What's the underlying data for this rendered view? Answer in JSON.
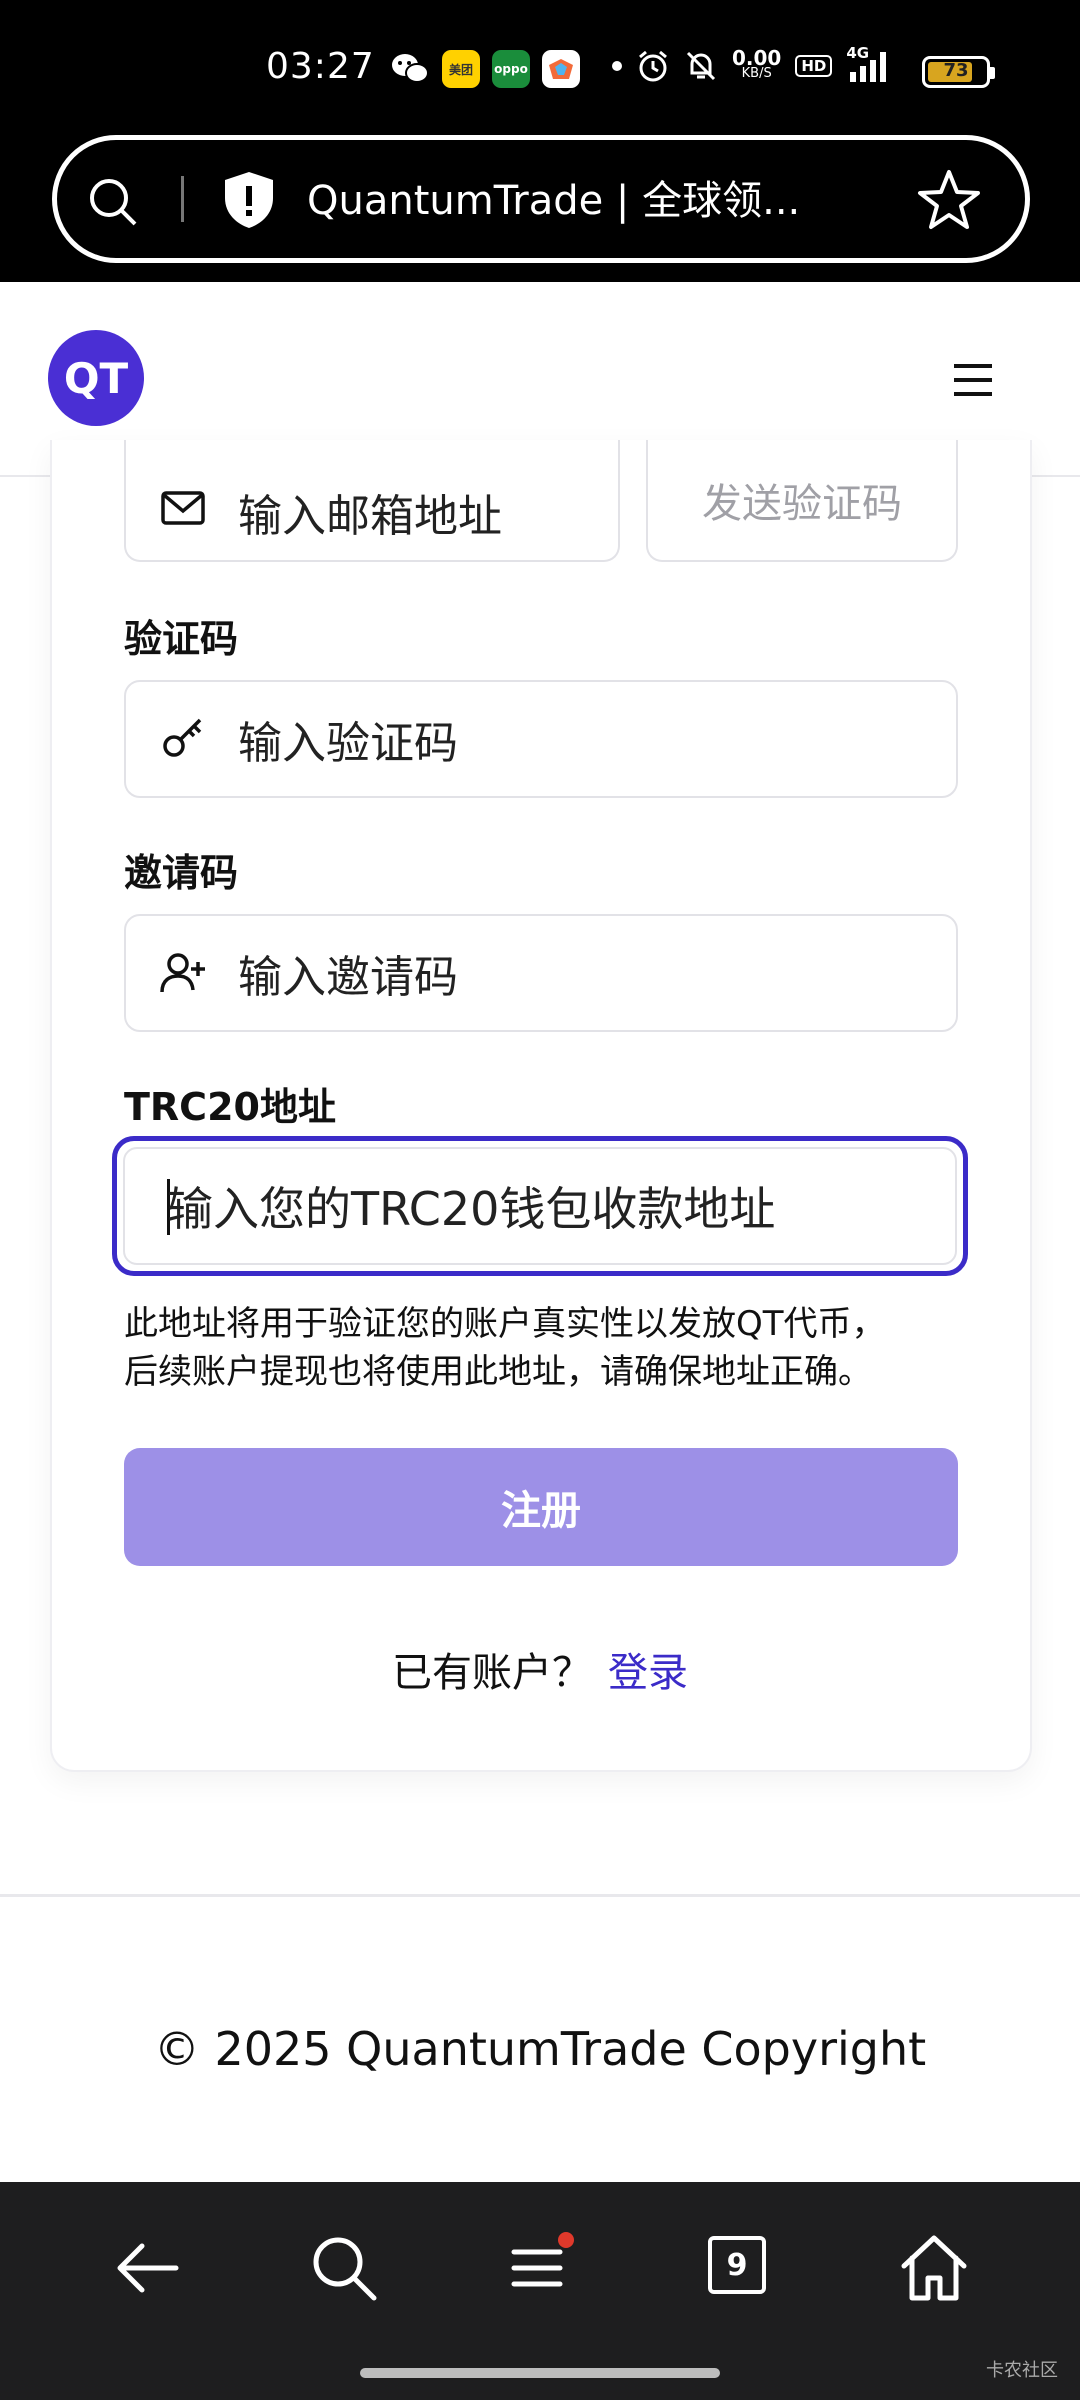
{
  "status_bar": {
    "time": "03:27",
    "net_speed": "0.00",
    "net_unit": "KB/S",
    "hd": "HD",
    "signal": "4G",
    "battery": "73"
  },
  "browser": {
    "url_title": "QuantumTrade | 全球领..."
  },
  "header": {
    "logo": "QT"
  },
  "form": {
    "email_placeholder": "输入邮箱地址",
    "send_code_label": "发送验证码",
    "code_label": "验证码",
    "code_placeholder": "输入验证码",
    "invite_label": "邀请码",
    "invite_placeholder": "输入邀请码",
    "trc_label": "TRC20地址",
    "trc_placeholder": "输入您的TRC20钱包收款地址",
    "note_line1": "此地址将用于验证您的账户真实性以发放QT代币，",
    "note_line2": "后续账户提现也将使用此地址，请确保地址正确。",
    "register_label": "注册",
    "have_account": "已有账户？",
    "login_label": "登录"
  },
  "footer": {
    "copyright": "© 2025 QuantumTrade Copyright"
  },
  "bottom_nav": {
    "tabs_count": "9"
  },
  "watermark": "卡农社区",
  "colors": {
    "brand": "#4a2fd4",
    "focus_border": "#3b2bc8",
    "button_disabled": "#9d90e7",
    "link": "#3b2bc8"
  }
}
